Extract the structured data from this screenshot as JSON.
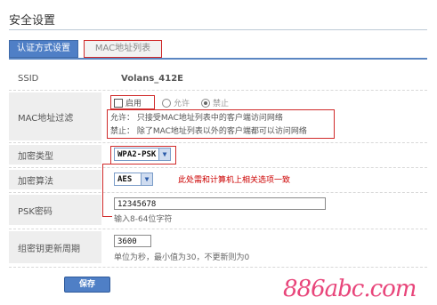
{
  "page_title": "安全设置",
  "tabs": [
    {
      "label": "认证方式设置",
      "active": true
    },
    {
      "label": "MAC地址列表",
      "active": false
    }
  ],
  "ssid": {
    "label": "SSID",
    "value": "Volans_412E"
  },
  "mac_filter": {
    "label": "MAC地址过滤",
    "enable_label": "启用",
    "enable_checked": false,
    "allow_label": "允许",
    "deny_label": "禁止",
    "selected": "禁止",
    "allow_desc": "允许：  只接受MAC地址列表中的客户端访问网络",
    "deny_desc": "禁止：  除了MAC地址列表以外的客户端都可以访问网络"
  },
  "encryption_type": {
    "label": "加密类型",
    "value": "WPA2-PSK"
  },
  "encryption_algo": {
    "label": "加密算法",
    "value": "AES",
    "note": "此处需和计算机上相关选项一致"
  },
  "psk": {
    "label": "PSK密码",
    "value": "12345678",
    "hint": "输入8-64位字符"
  },
  "group_key": {
    "label": "组密钥更新周期",
    "value": "3600",
    "hint": "单位为秒，最小值为30，不更新则为0"
  },
  "save_label": "保存",
  "watermark": "886abc.com",
  "colors": {
    "accent": "#4f7fc6",
    "highlight": "#d02a2a",
    "watermark": "#e8457a"
  }
}
